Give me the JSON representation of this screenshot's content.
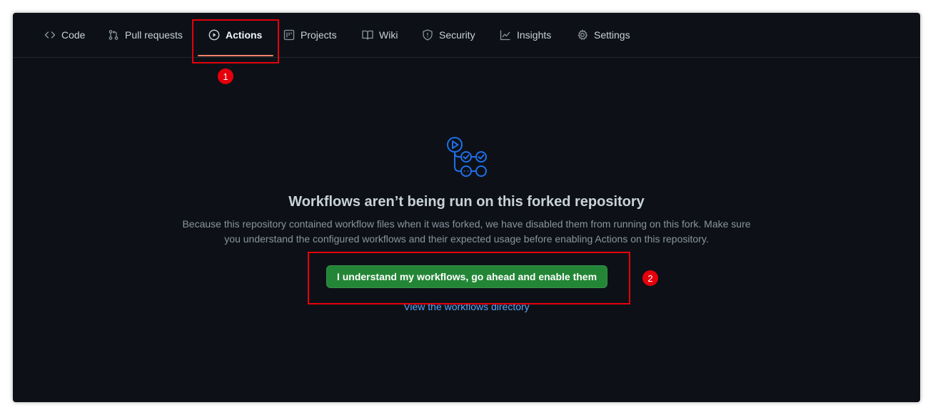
{
  "nav": {
    "tabs": [
      {
        "label": "Code",
        "icon": "code-icon"
      },
      {
        "label": "Pull requests",
        "icon": "pull-request-icon"
      },
      {
        "label": "Actions",
        "icon": "play-icon",
        "selected": true
      },
      {
        "label": "Projects",
        "icon": "project-icon"
      },
      {
        "label": "Wiki",
        "icon": "book-icon"
      },
      {
        "label": "Security",
        "icon": "shield-icon"
      },
      {
        "label": "Insights",
        "icon": "graph-icon"
      },
      {
        "label": "Settings",
        "icon": "gear-icon"
      }
    ]
  },
  "annotations": {
    "badge1": "1",
    "badge2": "2",
    "color": "#e5000c"
  },
  "main": {
    "icon": "workflow-icon",
    "heading": "Workflows aren’t being run on this forked repository",
    "description": "Because this repository contained workflow files when it was forked, we have disabled them from running on this fork. Make sure you understand the configured workflows and their expected usage before enabling Actions on this repository.",
    "enable_button": "I understand my workflows, go ahead and enable them",
    "directory_link": "View the workflows directory"
  },
  "colors": {
    "background": "#0d1117",
    "text": "#c9d1d9",
    "muted": "#8b949e",
    "accent_underline": "#f78166",
    "button_green": "#238636",
    "link": "#58a6ff",
    "icon_blue": "#1f6feb"
  }
}
